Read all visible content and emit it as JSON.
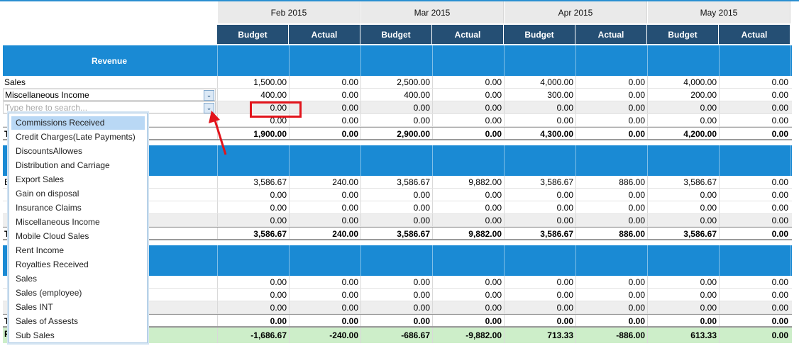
{
  "months": [
    "Feb 2015",
    "Mar 2015",
    "Apr 2015",
    "May 2015"
  ],
  "column_labels": {
    "budget": "Budget",
    "actual": "Actual"
  },
  "sections": {
    "revenue": {
      "label": "Revenue"
    }
  },
  "revenue_rows": [
    {
      "label": "Sales",
      "values": [
        "1,500.00",
        "0.00",
        "2,500.00",
        "0.00",
        "4,000.00",
        "0.00",
        "4,000.00",
        "0.00"
      ]
    },
    {
      "label": "Miscellaneous Income",
      "values": [
        "400.00",
        "0.00",
        "400.00",
        "0.00",
        "300.00",
        "0.00",
        "200.00",
        "0.00"
      ]
    },
    {
      "label": "",
      "placeholder": "Type here to search...",
      "values": [
        "0.00",
        "0.00",
        "0.00",
        "0.00",
        "0.00",
        "0.00",
        "0.00",
        "0.00"
      ]
    },
    {
      "label": "",
      "values": [
        "0.00",
        "0.00",
        "0.00",
        "0.00",
        "0.00",
        "0.00",
        "0.00",
        "0.00"
      ]
    }
  ],
  "revenue_total": {
    "label": "T",
    "values": [
      "1,900.00",
      "0.00",
      "2,900.00",
      "0.00",
      "4,300.00",
      "0.00",
      "4,200.00",
      "0.00"
    ]
  },
  "expense_rows": [
    {
      "label": "E",
      "values": [
        "3,586.67",
        "240.00",
        "3,586.67",
        "9,882.00",
        "3,586.67",
        "886.00",
        "3,586.67",
        "0.00"
      ]
    },
    {
      "label": "",
      "values": [
        "0.00",
        "0.00",
        "0.00",
        "0.00",
        "0.00",
        "0.00",
        "0.00",
        "0.00"
      ]
    },
    {
      "label": "",
      "values": [
        "0.00",
        "0.00",
        "0.00",
        "0.00",
        "0.00",
        "0.00",
        "0.00",
        "0.00"
      ]
    },
    {
      "label": "",
      "values": [
        "0.00",
        "0.00",
        "0.00",
        "0.00",
        "0.00",
        "0.00",
        "0.00",
        "0.00"
      ]
    }
  ],
  "expense_total": {
    "label": "T",
    "values": [
      "3,586.67",
      "240.00",
      "3,586.67",
      "9,882.00",
      "3,586.67",
      "886.00",
      "3,586.67",
      "0.00"
    ]
  },
  "other_rows": [
    {
      "label": "",
      "values": [
        "0.00",
        "0.00",
        "0.00",
        "0.00",
        "0.00",
        "0.00",
        "0.00",
        "0.00"
      ]
    },
    {
      "label": "",
      "values": [
        "0.00",
        "0.00",
        "0.00",
        "0.00",
        "0.00",
        "0.00",
        "0.00",
        "0.00"
      ]
    },
    {
      "label": "",
      "values": [
        "0.00",
        "0.00",
        "0.00",
        "0.00",
        "0.00",
        "0.00",
        "0.00",
        "0.00"
      ]
    }
  ],
  "other_total": {
    "label": "T",
    "values": [
      "0.00",
      "0.00",
      "0.00",
      "0.00",
      "0.00",
      "0.00",
      "0.00",
      "0.00"
    ]
  },
  "profit_row": {
    "label": "P",
    "values": [
      "-1,686.67",
      "-240.00",
      "-686.67",
      "-9,882.00",
      "713.33",
      "-886.00",
      "613.33",
      "0.00"
    ]
  },
  "dropdown": {
    "selected_index": 0,
    "items": [
      "Commissions Received",
      "Credit Charges(Late Payments)",
      "DiscountsAllowes",
      "Distribution and Carriage",
      "Export Sales",
      "Gain on disposal",
      "Insurance Claims",
      "Miscellaneous Income",
      "Mobile Cloud Sales",
      "Rent Income",
      "Royalties Received",
      "Sales",
      "Sales (employee)",
      "Sales INT",
      "Sales of Assests",
      "Sub Sales"
    ]
  },
  "colors": {
    "header_dark": "#254f74",
    "band_blue": "#1a8ad4",
    "profit_green": "#cdeec9",
    "highlight_red": "#e2141c"
  },
  "icons": {
    "dropdown_toggle": "chevron-down-icon",
    "annotation": "red-arrow"
  }
}
